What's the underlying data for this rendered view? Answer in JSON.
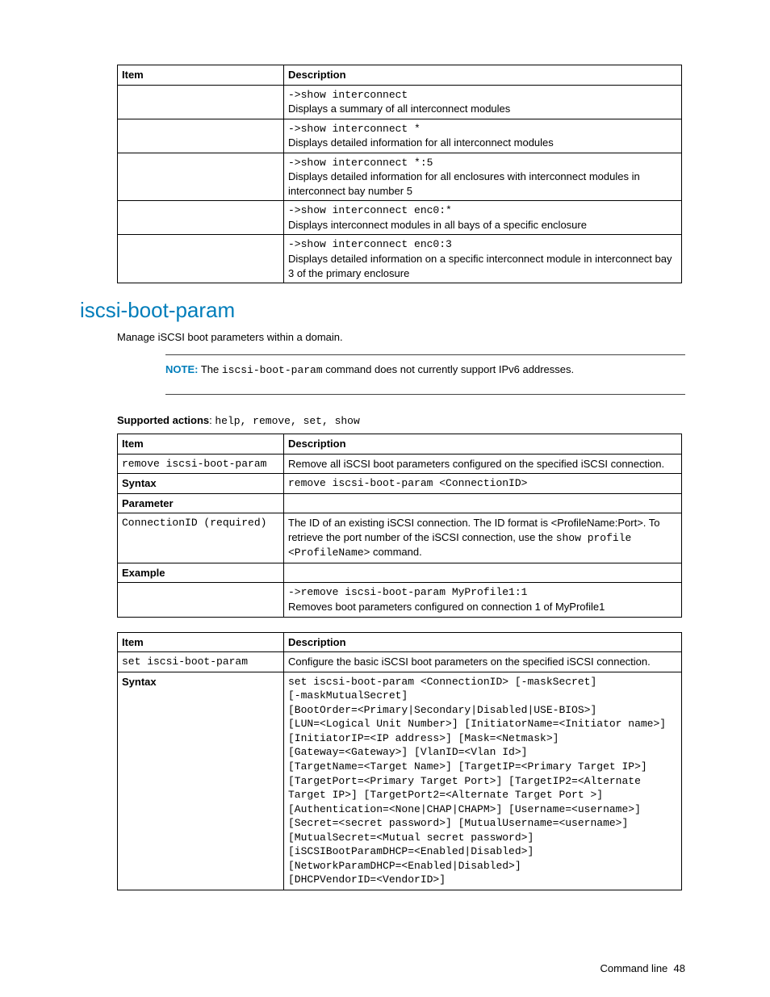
{
  "table1": {
    "headers": {
      "item": "Item",
      "desc": "Description"
    },
    "rows": [
      {
        "item": "",
        "cmd": "->show interconnect",
        "desc": "Displays a summary of all interconnect modules"
      },
      {
        "item": "",
        "cmd": "->show interconnect *",
        "desc": "Displays detailed information for all interconnect modules"
      },
      {
        "item": "",
        "cmd": "->show interconnect *:5",
        "desc": "Displays detailed information for all enclosures with interconnect modules in interconnect bay number 5"
      },
      {
        "item": "",
        "cmd": "->show interconnect enc0:*",
        "desc": "Displays interconnect modules in all bays of a specific enclosure"
      },
      {
        "item": "",
        "cmd": "->show interconnect enc0:3",
        "desc": "Displays detailed information on a specific interconnect module in interconnect bay 3 of the primary enclosure"
      }
    ]
  },
  "section": {
    "title": "iscsi-boot-param",
    "intro": "Manage iSCSI boot parameters within a domain.",
    "note_label": "NOTE:",
    "note_pre": "  The ",
    "note_cmd": "iscsi-boot-param",
    "note_post": " command does not currently support IPv6 addresses.",
    "supported_label": "Supported actions",
    "supported_sep": ": ",
    "supported_vals": "help, remove, set, show"
  },
  "table2": {
    "headers": {
      "item": "Item",
      "desc": "Description"
    },
    "r1": {
      "item": "remove iscsi-boot-param",
      "desc": "Remove all iSCSI boot parameters configured on the specified iSCSI connection."
    },
    "syntax_label": "Syntax",
    "syntax_val": "remove iscsi-boot-param <ConnectionID>",
    "param_label": "Parameter",
    "param_item": "ConnectionID (required)",
    "param_desc_a": "The ID of an existing iSCSI connection. The ID format is <ProfileName:Port>. To retrieve the port number of the iSCSI connection, use the ",
    "param_desc_code": "show profile <ProfileName>",
    "param_desc_b": " command.",
    "example_label": "Example",
    "example_cmd": "->remove iscsi-boot-param MyProfile1:1",
    "example_desc": "Removes boot parameters configured on connection 1 of MyProfile1"
  },
  "table3": {
    "headers": {
      "item": "Item",
      "desc": "Description"
    },
    "r1": {
      "item": "set iscsi-boot-param",
      "desc": "Configure the basic iSCSI boot parameters on the specified iSCSI connection."
    },
    "syntax_label": "Syntax",
    "syntax_val": "set iscsi-boot-param <ConnectionID> [-maskSecret]\n[-maskMutualSecret]\n[BootOrder=<Primary|Secondary|Disabled|USE-BIOS>]\n[LUN=<Logical Unit Number>] [InitiatorName=<Initiator name>] [InitiatorIP=<IP address>] [Mask=<Netmask>]\n[Gateway=<Gateway>] [VlanID=<Vlan Id>]\n[TargetName=<Target Name>] [TargetIP=<Primary Target IP>]\n[TargetPort=<Primary Target Port>] [TargetIP2=<Alternate Target IP>] [TargetPort2=<Alternate Target Port >]\n[Authentication=<None|CHAP|CHAPM>] [Username=<username>]\n[Secret=<secret password>] [MutualUsername=<username>]\n[MutualSecret=<Mutual secret password>]\n[iSCSIBootParamDHCP=<Enabled|Disabled>]\n[NetworkParamDHCP=<Enabled|Disabled>]\n[DHCPVendorID=<VendorID>]"
  },
  "footer": {
    "label": "Command line",
    "page": "48"
  }
}
